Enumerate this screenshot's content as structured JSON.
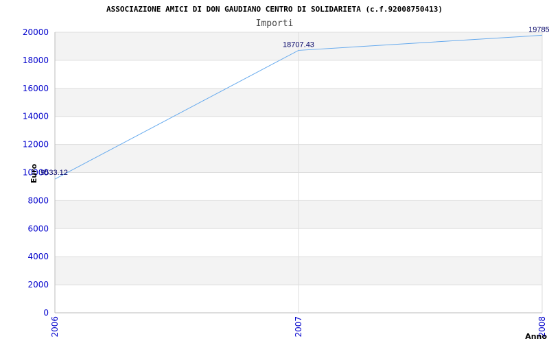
{
  "chart_data": {
    "type": "line",
    "title": "ASSOCIAZIONE AMICI DI DON GAUDIANO CENTRO DI SOLIDARIETA (c.f.92008750413)",
    "subtitle": "Importi",
    "xlabel": "Anno",
    "ylabel": "Euro",
    "categories": [
      "2006",
      "2007",
      "2008"
    ],
    "series": [
      {
        "values": [
          9533.12,
          18707.43,
          19785.0
        ],
        "labels": [
          "9533.12",
          "18707.43",
          "19785.0"
        ]
      }
    ],
    "ylim": [
      0,
      20000
    ],
    "yticks": [
      0,
      2000,
      4000,
      6000,
      8000,
      10000,
      12000,
      14000,
      16000,
      18000,
      20000
    ],
    "grid": true,
    "colors": {
      "line": "#66aaee",
      "band_alt": "#f3f3f3",
      "band": "#ffffff",
      "gridline": "#dddddd",
      "axis": "#bbbbbb",
      "tick_text": "#0000cc",
      "data_label": "#000066"
    }
  }
}
